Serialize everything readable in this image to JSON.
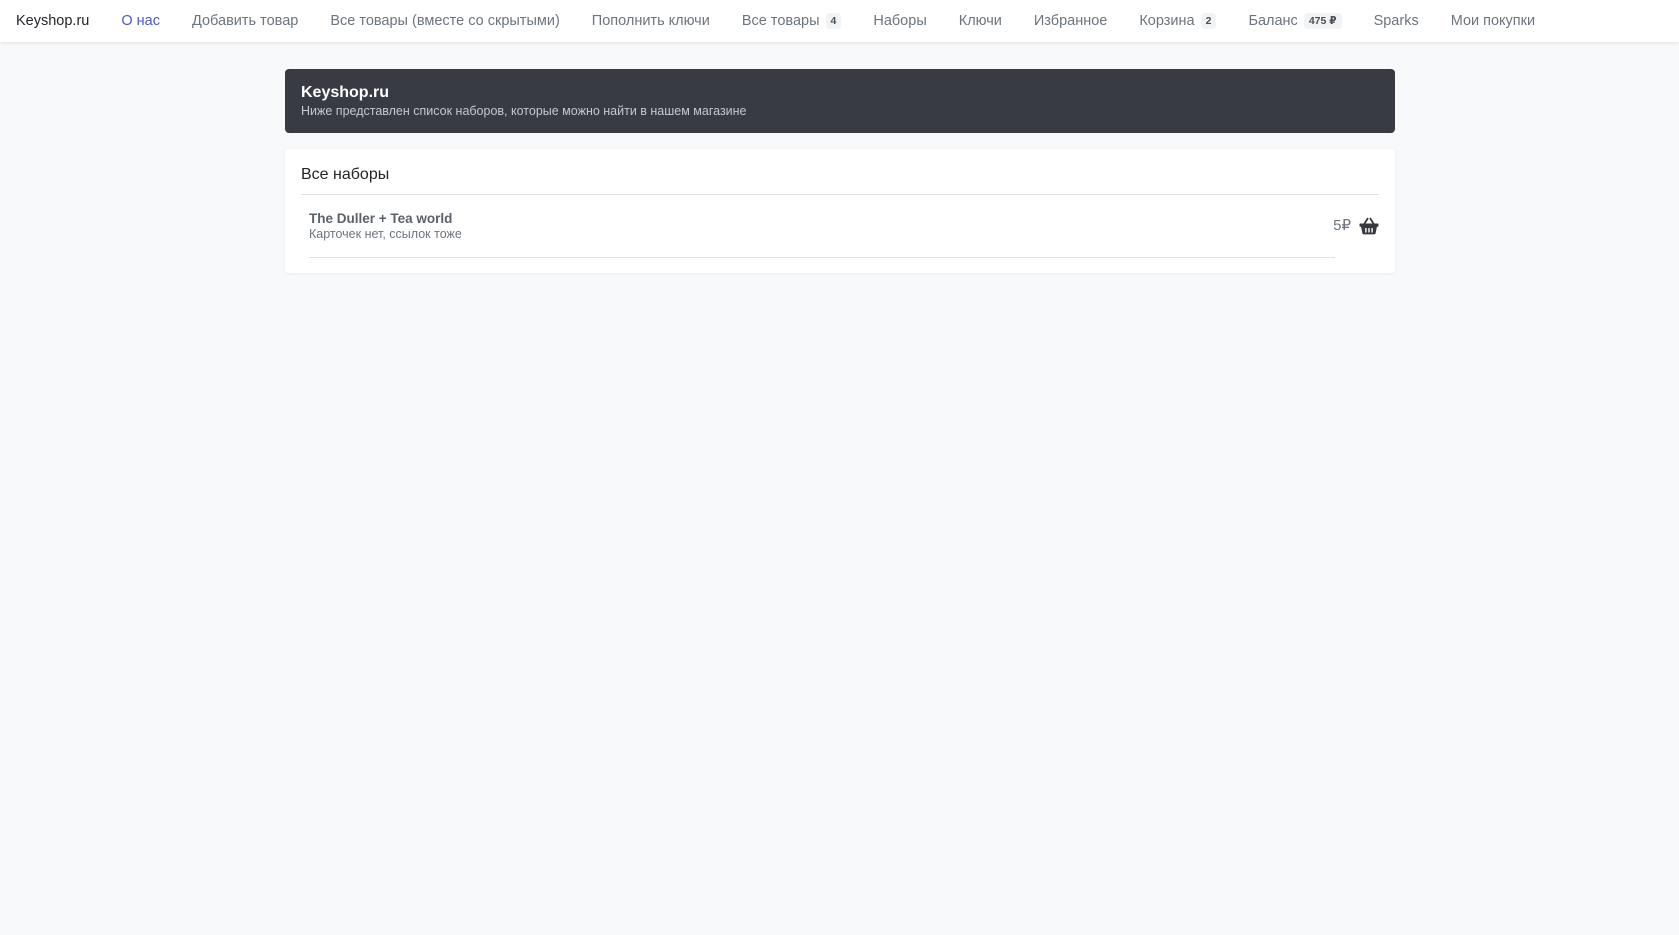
{
  "navbar": {
    "brand": "Keyshop.ru",
    "links": [
      {
        "label": "О нас",
        "active": true
      },
      {
        "label": "Добавить товар"
      },
      {
        "label": "Все товары (вместе со скрытыми)"
      },
      {
        "label": "Пополнить ключи"
      },
      {
        "label": "Все товары",
        "badge": "4"
      },
      {
        "label": "Наборы"
      },
      {
        "label": "Ключи"
      },
      {
        "label": "Избранное"
      },
      {
        "label": "Корзина",
        "badge": "2"
      },
      {
        "label": "Баланс",
        "badge": "475 ₽"
      },
      {
        "label": "Sparks"
      },
      {
        "label": "Мои покупки"
      }
    ]
  },
  "header": {
    "title": "Keyshop.ru",
    "subtitle": "Ниже представлен список наборов, которые можно найти в нашем магазине"
  },
  "bundles": {
    "section_title": "Все наборы",
    "items": [
      {
        "name": "The Duller + Tea world",
        "description": "Карточек нет, ссылок тоже",
        "price": "5₽",
        "icon": "basket-icon"
      }
    ]
  },
  "colors": {
    "active_link": "#4a58d0",
    "header_bg": "#383b44",
    "page_bg": "#f8f9fa"
  }
}
